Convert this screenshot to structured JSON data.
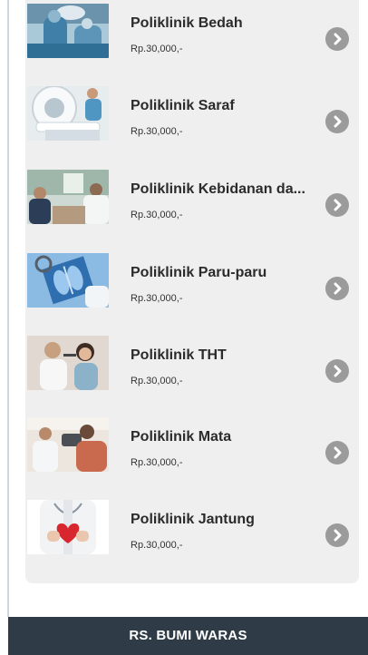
{
  "clinics": [
    {
      "name": "Poliklinik Bedah",
      "price": "Rp.30,000,-",
      "icon": "surgery-photo"
    },
    {
      "name": "Poliklinik Saraf",
      "price": "Rp.30,000,-",
      "icon": "mri-scan-photo"
    },
    {
      "name": "Poliklinik Kebidanan da...",
      "price": "Rp.30,000,-",
      "icon": "doctor-consultation-photo"
    },
    {
      "name": "Poliklinik Paru-paru",
      "price": "Rp.30,000,-",
      "icon": "chest-xray-photo"
    },
    {
      "name": "Poliklinik THT",
      "price": "Rp.30,000,-",
      "icon": "ent-exam-photo"
    },
    {
      "name": "Poliklinik Mata",
      "price": "Rp.30,000,-",
      "icon": "eye-exam-photo"
    },
    {
      "name": "Poliklinik Jantung",
      "price": "Rp.30,000,-",
      "icon": "heart-doctor-photo"
    }
  ],
  "footer": {
    "title": "RS. BUMI WARAS"
  },
  "colors": {
    "card_background": "#efefef",
    "chevron": "#9b9b9b",
    "footer_background": "#2f3c48"
  }
}
